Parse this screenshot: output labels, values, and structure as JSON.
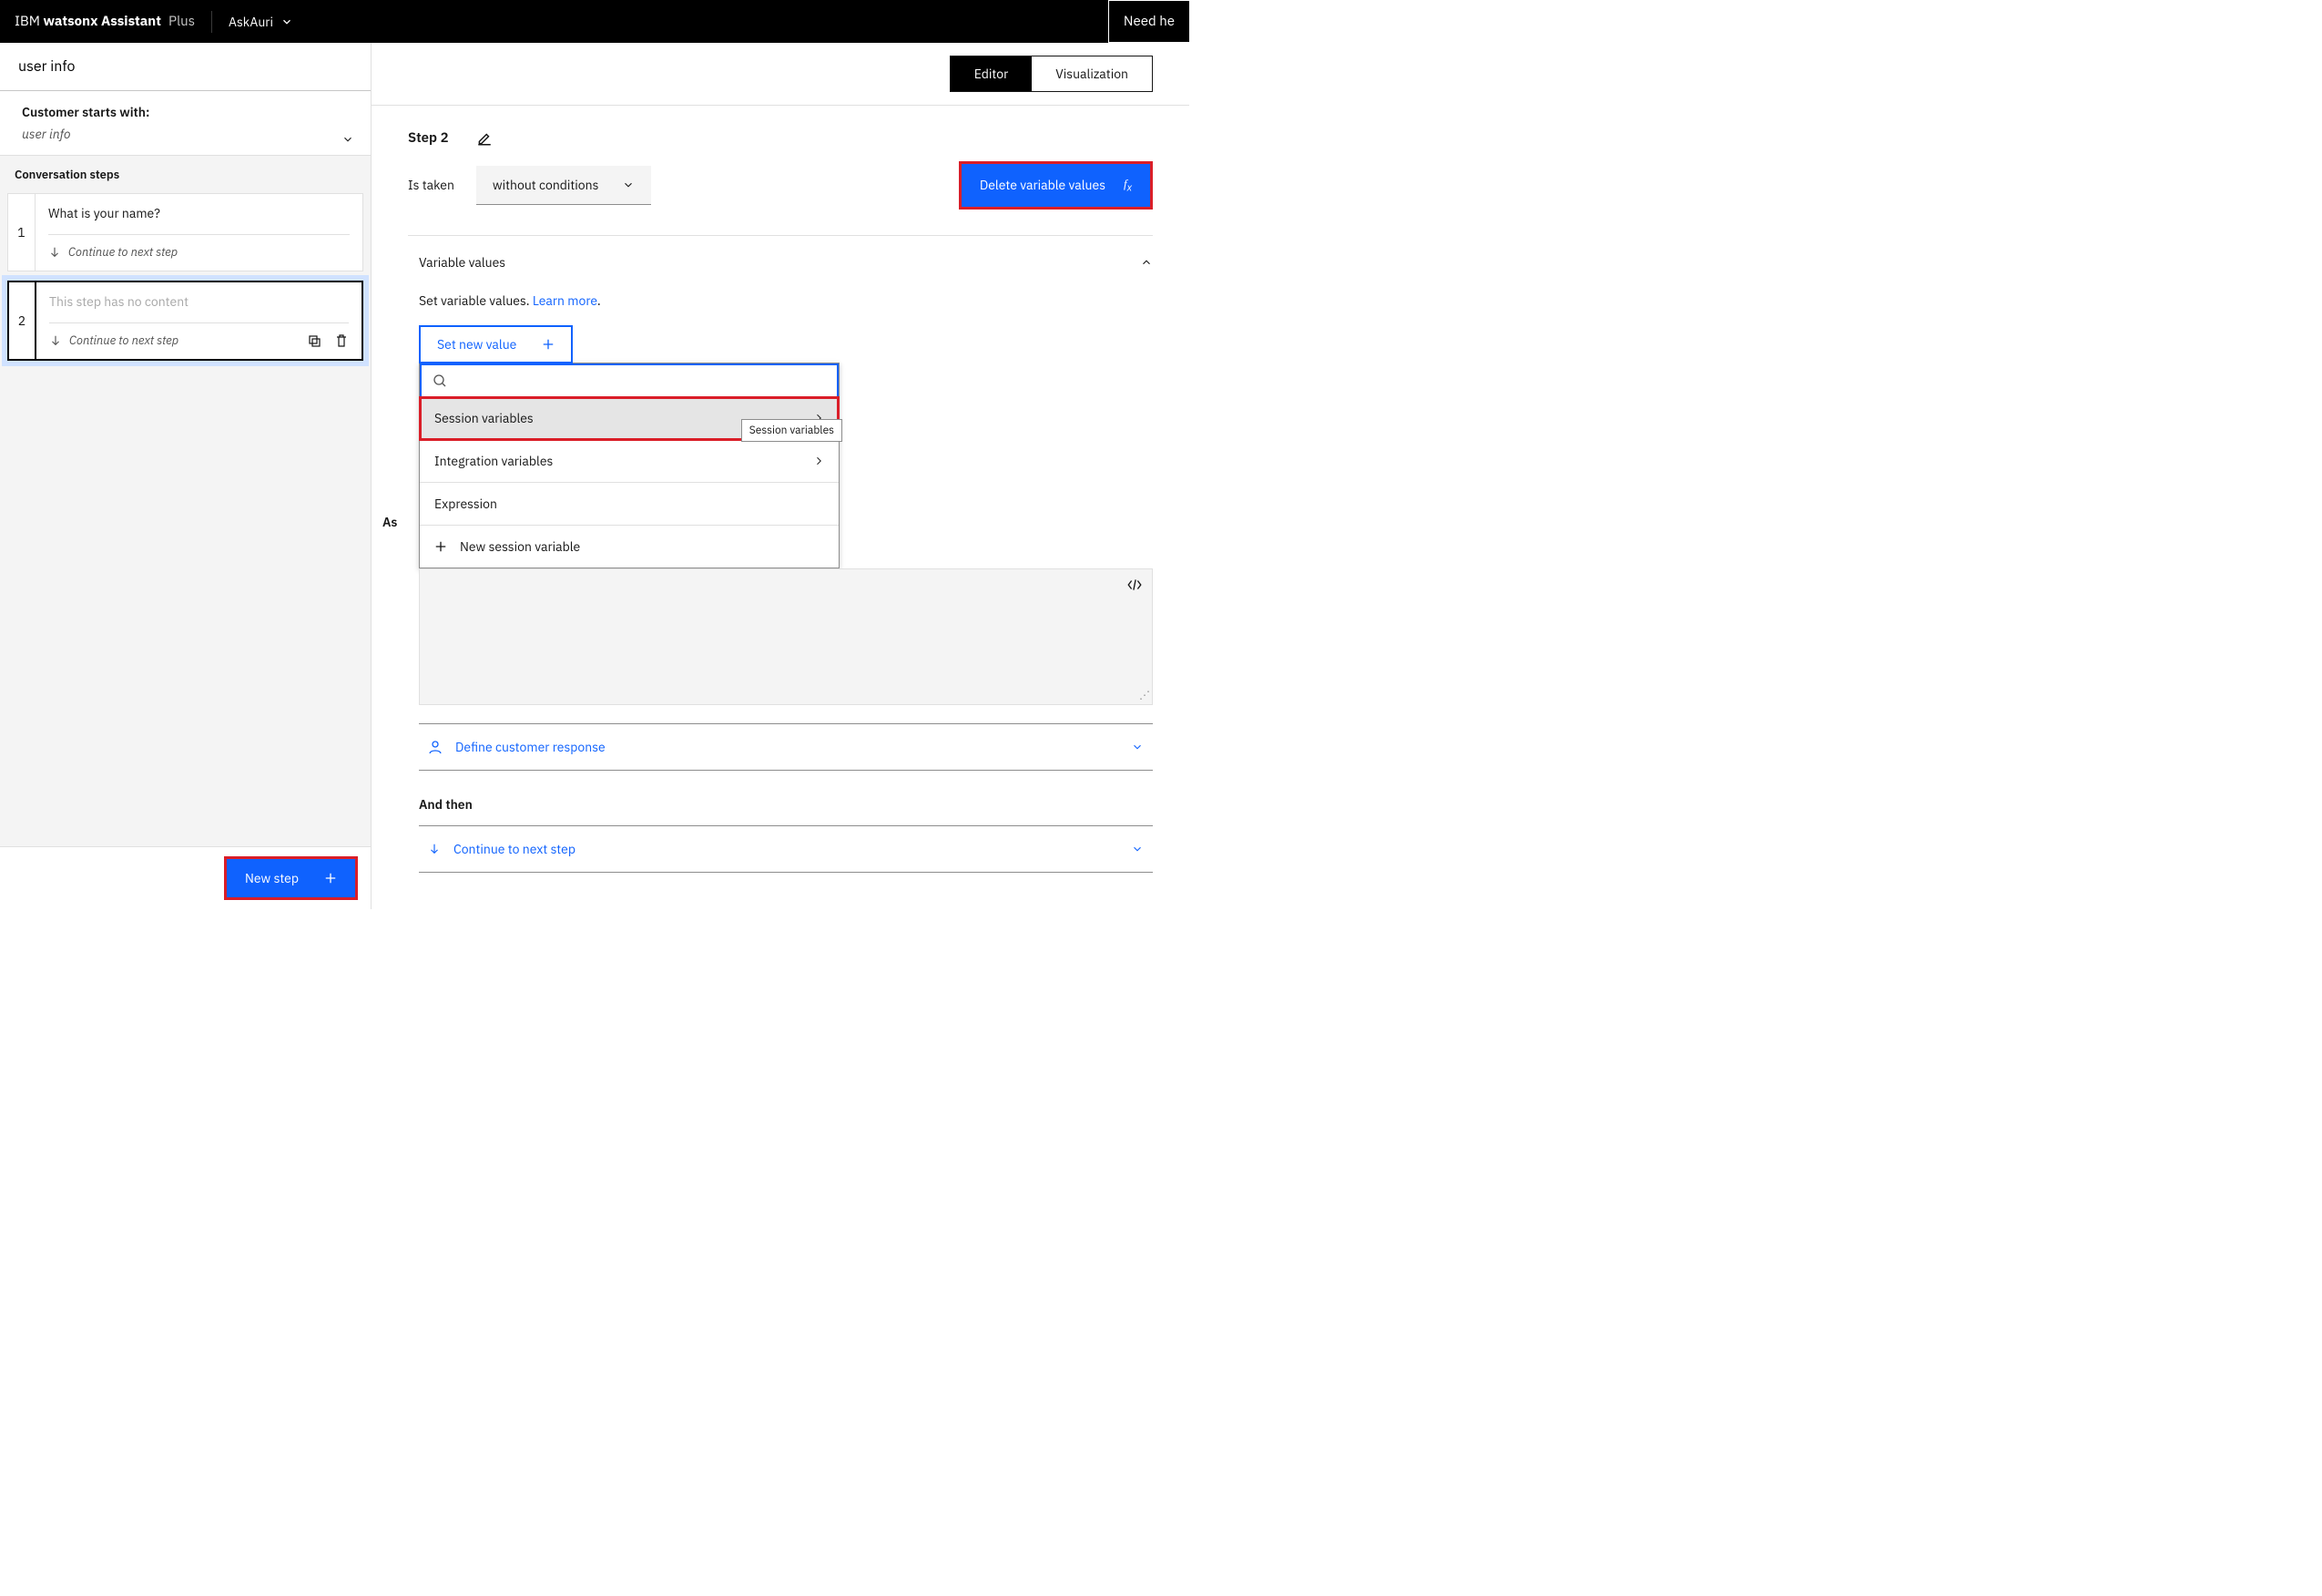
{
  "header": {
    "brand_prefix": "IBM ",
    "brand_bold": "watsonx Assistant",
    "plan": "Plus",
    "project": "AskAuri",
    "need_help": "Need he"
  },
  "left": {
    "action_name": "user info",
    "customer_starts_label": "Customer starts with:",
    "customer_starts_example": "user info",
    "conversation_steps_label": "Conversation steps",
    "steps": [
      {
        "num": "1",
        "question": "What is your name?",
        "continue": "Continue to next step"
      },
      {
        "num": "2",
        "empty": "This step has no content",
        "continue": "Continue to next step"
      }
    ],
    "new_step": "New step"
  },
  "tabs": {
    "editor": "Editor",
    "visualization": "Visualization"
  },
  "step_detail": {
    "title": "Step 2",
    "is_taken_label": "Is taken",
    "condition_value": "without conditions",
    "delete_btn": "Delete variable values",
    "variable_values_heading": "Variable values",
    "variable_values_sub_pre": "Set variable values. ",
    "variable_values_learn": "Learn more",
    "variable_values_sub_post": ".",
    "set_new_value": "Set new value",
    "popover": {
      "search_placeholder": "",
      "items": {
        "session": "Session variables",
        "integration": "Integration variables",
        "expression": "Expression",
        "new_session": "New session variable"
      },
      "tooltip": "Session variables"
    },
    "assist_truncated": "As",
    "define_response": "Define customer response",
    "and_then": "And then",
    "continue_next": "Continue to next step"
  }
}
